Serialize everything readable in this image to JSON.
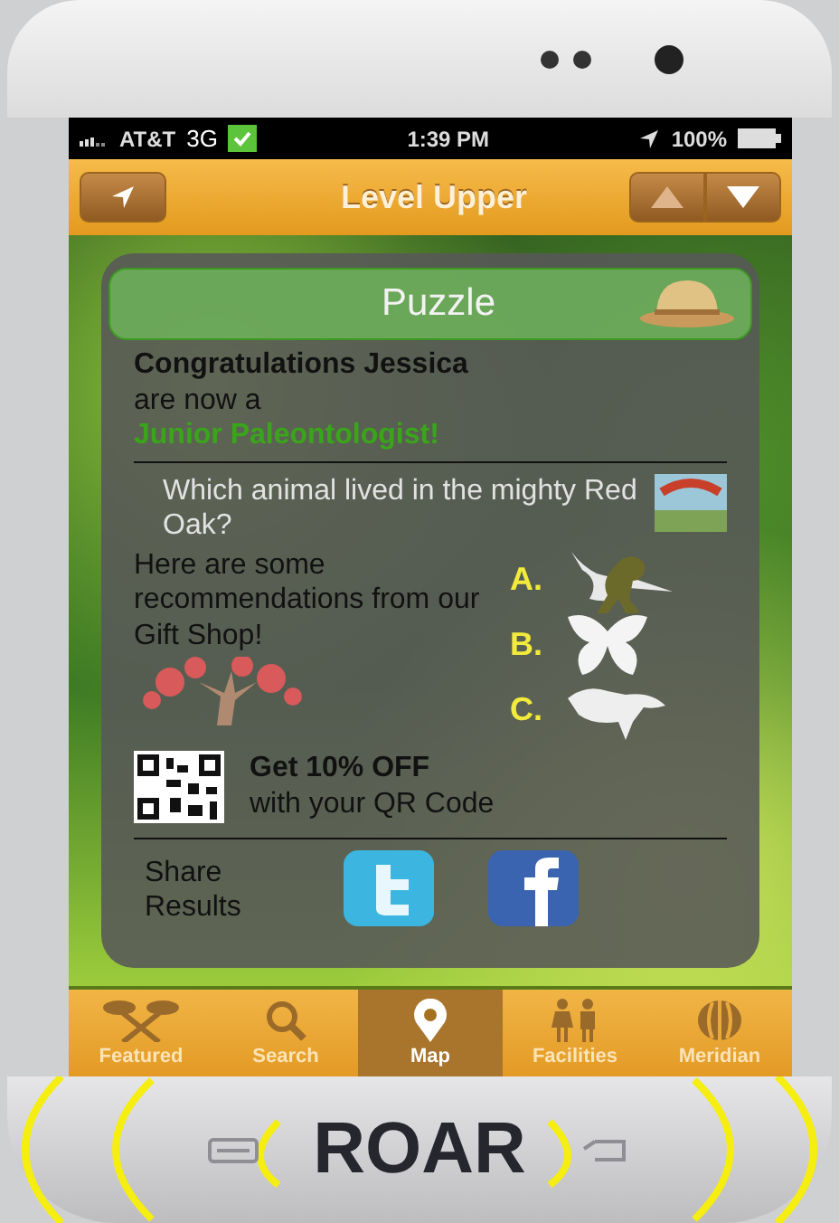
{
  "status_bar": {
    "carrier": "AT&T",
    "network": "3G",
    "time": "1:39 PM",
    "battery": "100%"
  },
  "nav_bar": {
    "title": "Level Upper"
  },
  "puzzle": {
    "title": "Puzzle",
    "question": "Which animal lived in the mighty Red Oak?",
    "options": [
      {
        "letter": "A.",
        "kind": "dinosaur"
      },
      {
        "letter": "B.",
        "kind": "butterfly"
      },
      {
        "letter": "C.",
        "kind": "bird"
      }
    ]
  },
  "congrats": {
    "heading": "Congratulations Jessica",
    "line": "are now a",
    "title": "Junior Paleontologist!",
    "gift_text": "Here are some recommendations from our Gift Shop!",
    "coupon_title": "Get 10% OFF",
    "coupon_text": "with your QR Code",
    "share_label": "Share Results"
  },
  "tab_bar": [
    {
      "label": "Featured",
      "kind": "dining",
      "selected": false
    },
    {
      "label": "Search",
      "kind": "search",
      "selected": false
    },
    {
      "label": "Map",
      "kind": "pin",
      "selected": true
    },
    {
      "label": "Facilities",
      "kind": "restroom",
      "selected": false
    },
    {
      "label": "Meridian",
      "kind": "globe",
      "selected": false
    }
  ],
  "device": {
    "label": "ROAR"
  }
}
